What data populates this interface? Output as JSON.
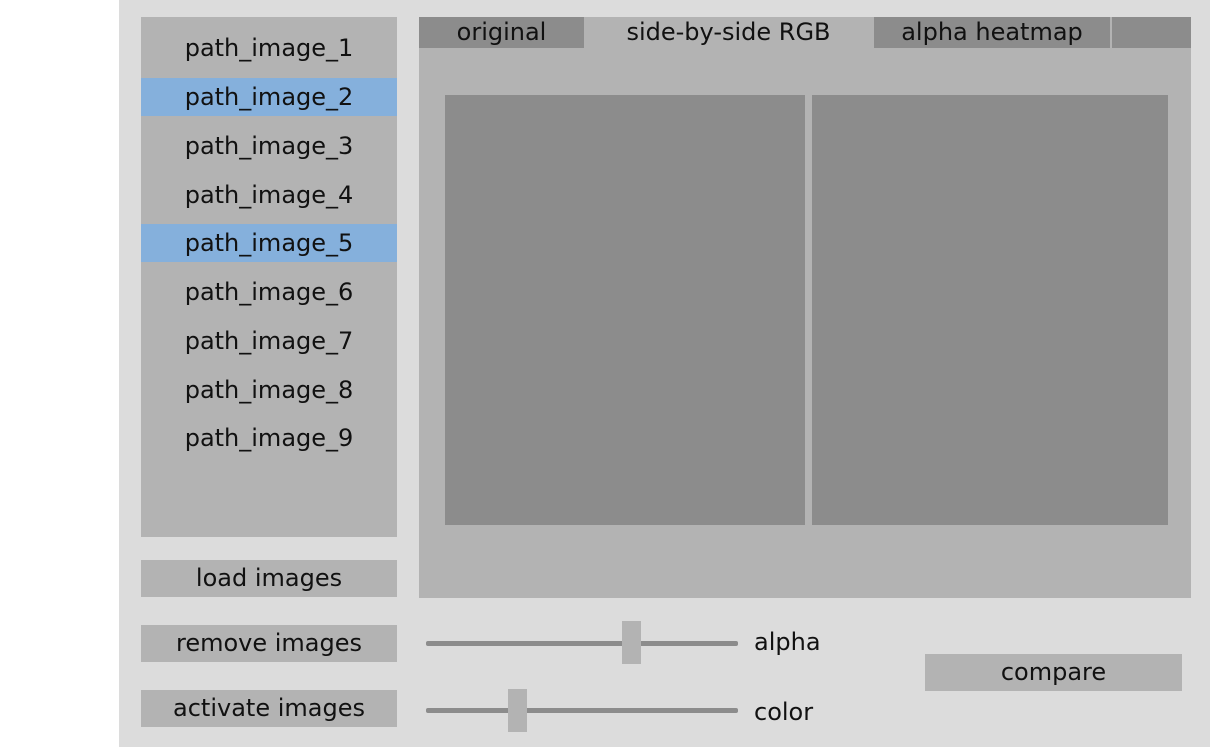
{
  "images": {
    "items": [
      {
        "label": "path_image_1",
        "selected": false
      },
      {
        "label": "path_image_2",
        "selected": true
      },
      {
        "label": "path_image_3",
        "selected": false
      },
      {
        "label": "path_image_4",
        "selected": false
      },
      {
        "label": "path_image_5",
        "selected": true
      },
      {
        "label": "path_image_6",
        "selected": false
      },
      {
        "label": "path_image_7",
        "selected": false
      },
      {
        "label": "path_image_8",
        "selected": false
      },
      {
        "label": "path_image_9",
        "selected": false
      }
    ]
  },
  "buttons": {
    "load": "load images",
    "remove": "remove images",
    "activate": "activate images",
    "compare": "compare"
  },
  "tabs": [
    {
      "label": "original",
      "active": false
    },
    {
      "label": "side-by-side RGB",
      "active": true
    },
    {
      "label": "alpha heatmap",
      "active": false
    }
  ],
  "sliders": {
    "alpha": {
      "label": "alpha",
      "value": 0.67
    },
    "color": {
      "label": "color",
      "value": 0.28
    }
  },
  "colors": {
    "selected_highlight": "#85b0dc",
    "panel": "#b3b3b3",
    "image_placeholder": "#8c8c8c",
    "background": "#dcdcdc"
  }
}
